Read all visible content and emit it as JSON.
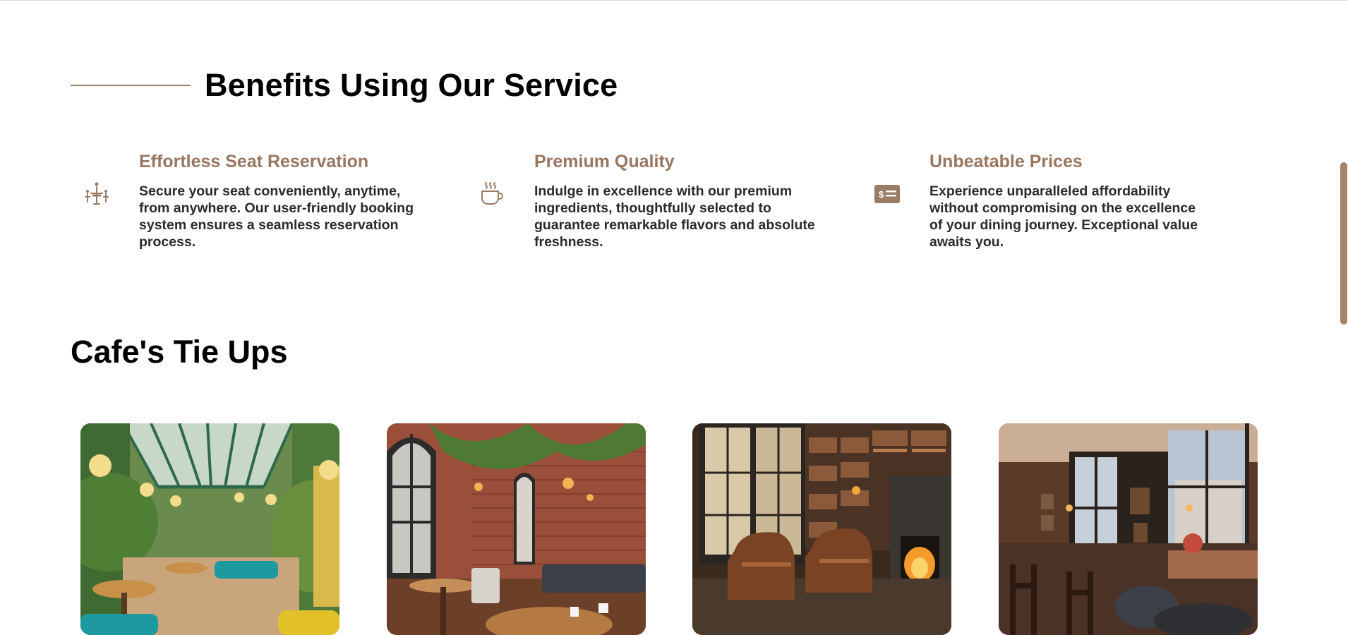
{
  "benefits": {
    "heading": "Benefits Using Our Service",
    "items": [
      {
        "icon": "seat-reservation-icon",
        "title": "Effortless Seat Reservation",
        "description": "Secure your seat conveniently, anytime, from anywhere. Our user-friendly booking system ensures a seamless reservation process."
      },
      {
        "icon": "coffee-cup-icon",
        "title": "Premium Quality",
        "description": "Indulge in excellence with our premium ingredients, thoughtfully selected to guarantee remarkable flavors and absolute freshness."
      },
      {
        "icon": "price-tag-icon",
        "title": "Unbeatable Prices",
        "description": "Experience unparalleled affordability without compromising on the excellence of your dining journey. Exceptional value awaits you."
      }
    ]
  },
  "tie_ups": {
    "heading": "Cafe's Tie Ups",
    "cards": [
      {
        "image": "greenhouse-cafe-photo"
      },
      {
        "image": "brick-wall-cafe-photo"
      },
      {
        "image": "library-fireplace-cafe-photo"
      },
      {
        "image": "window-view-cafe-photo"
      }
    ]
  },
  "colors": {
    "accent": "#987660",
    "scrollbar": "#a68469",
    "text": "#2b2b2b"
  }
}
